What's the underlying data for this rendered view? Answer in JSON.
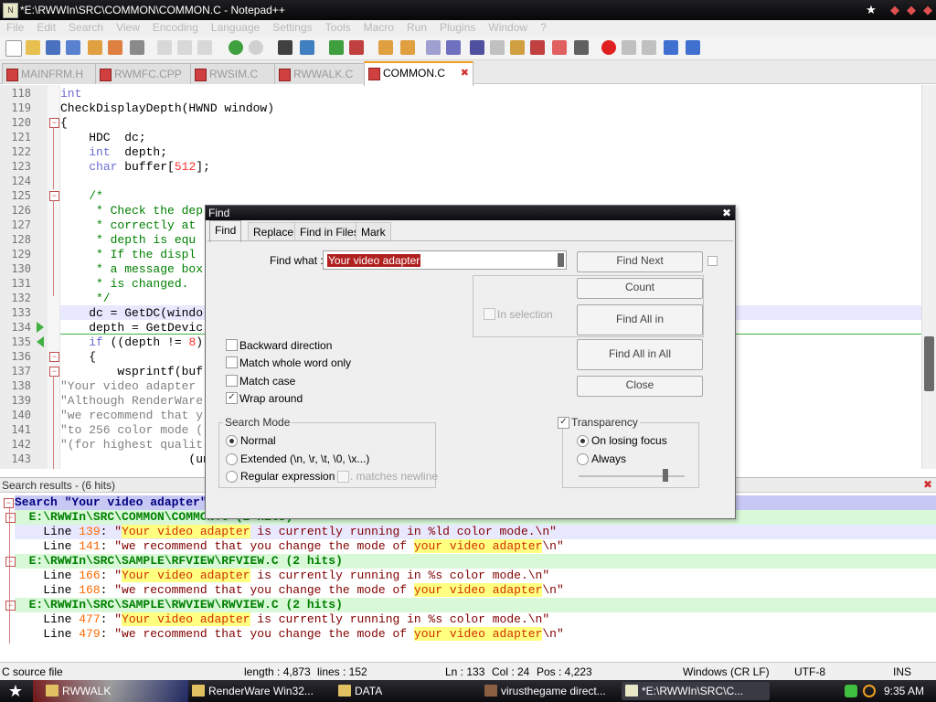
{
  "window": {
    "title": "*E:\\RWWIn\\SRC\\COMMON\\COMMON.C - Notepad++",
    "app_icon": "notepad-plus-icon"
  },
  "menu": [
    "File",
    "Edit",
    "Search",
    "View",
    "Encoding",
    "Language",
    "Settings",
    "Tools",
    "Macro",
    "Run",
    "Plugins",
    "Window",
    "?"
  ],
  "tabs": [
    {
      "label": "MAINFRM.H",
      "active": false
    },
    {
      "label": "RWMFC.CPP",
      "active": false
    },
    {
      "label": "RWSIM.C",
      "active": false
    },
    {
      "label": "RWWALK.C",
      "active": false
    },
    {
      "label": "COMMON.C",
      "active": true
    }
  ],
  "editor": {
    "lines": [
      {
        "n": "118",
        "t": "int"
      },
      {
        "n": "119",
        "t": "CheckDisplayDepth(HWND window)"
      },
      {
        "n": "120",
        "t": "{"
      },
      {
        "n": "121",
        "t": "    HDC  dc;"
      },
      {
        "n": "122",
        "t": "    int  depth;"
      },
      {
        "n": "123",
        "t": "    char buffer[512];"
      },
      {
        "n": "124",
        "t": ""
      },
      {
        "n": "125",
        "t": "    /*"
      },
      {
        "n": "126",
        "t": "     * Check the dep"
      },
      {
        "n": "127",
        "t": "     * correctly at"
      },
      {
        "n": "128",
        "t": "     * depth is equ"
      },
      {
        "n": "129",
        "t": "     * If the displ"
      },
      {
        "n": "130",
        "t": "     * a message box"
      },
      {
        "n": "131",
        "t": "     * is changed."
      },
      {
        "n": "132",
        "t": "     */"
      },
      {
        "n": "133",
        "t": "    dc = GetDC(windo"
      },
      {
        "n": "134",
        "t": "    depth = GetDevic"
      },
      {
        "n": "135",
        "t": "    if ((depth != 8)"
      },
      {
        "n": "136",
        "t": "    {"
      },
      {
        "n": "137",
        "t": "        wsprintf(buf"
      },
      {
        "n": "138",
        "t": "\"Your video adapter"
      },
      {
        "n": "139",
        "t": "\"Although RenderWare"
      },
      {
        "n": "140",
        "t": "\"we recommend that y"
      },
      {
        "n": "141",
        "t": "\"to 256 color mode ("
      },
      {
        "n": "142",
        "t": "\"(for highest qualit"
      },
      {
        "n": "143",
        "t": "                  (un"
      }
    ]
  },
  "search_results": {
    "title": "Search results - (6 hits)",
    "query_line": "Search \"Your video adapter\" (6 hits in 3 files)",
    "files": [
      {
        "path": "E:\\RWWIn\\SRC\\COMMON\\COMMON.C (2 hits)",
        "hits": [
          {
            "prefix": "Line ",
            "num": "139",
            "colon": ": ",
            "pre": "\"",
            "hit": "Your video adapter",
            "post": " is currently running in %ld color mode.\\n\""
          },
          {
            "prefix": "Line ",
            "num": "141",
            "colon": ": ",
            "pre": "\"we recommend that you change the mode of ",
            "hit": "your video adapter",
            "post": "\\n\""
          }
        ]
      },
      {
        "path": "E:\\RWWIn\\SRC\\SAMPLE\\RFVIEW\\RFVIEW.C (2 hits)",
        "hits": [
          {
            "prefix": "Line ",
            "num": "166",
            "colon": ": ",
            "pre": "\"",
            "hit": "Your video adapter",
            "post": " is currently running in %s color mode.\\n\""
          },
          {
            "prefix": "Line ",
            "num": "168",
            "colon": ": ",
            "pre": "\"we recommend that you change the mode of ",
            "hit": "your video adapter",
            "post": "\\n\""
          }
        ]
      },
      {
        "path": "E:\\RWWIn\\SRC\\SAMPLE\\RWVIEW\\RWVIEW.C (2 hits)",
        "hits": [
          {
            "prefix": "Line ",
            "num": "477",
            "colon": ": ",
            "pre": "\"",
            "hit": "Your video adapter",
            "post": " is currently running in %s color mode.\\n\""
          },
          {
            "prefix": "Line ",
            "num": "479",
            "colon": ": ",
            "pre": "\"we recommend that you change the mode of ",
            "hit": "your video adapter",
            "post": "\\n\""
          }
        ]
      }
    ]
  },
  "find_dialog": {
    "title": "Find",
    "tabs": [
      "Find",
      "Replace",
      "Find in Files",
      "Mark"
    ],
    "find_what_label": "Find what :",
    "find_what_value": "Your video adapter",
    "buttons": {
      "find_next": "Find Next",
      "count": "Count",
      "find_all_in": "Find All in",
      "find_all_in_all": "Find All in All",
      "close": "Close"
    },
    "in_selection": "In selection",
    "options": {
      "backward": "Backward direction",
      "whole_word": "Match whole word only",
      "match_case": "Match case",
      "wrap_around": "Wrap around"
    },
    "search_mode": {
      "title": "Search Mode",
      "normal": "Normal",
      "extended": "Extended (\\n, \\r, \\t, \\0, \\x...)",
      "regex": "Regular expression",
      "matches_newline": ". matches newline"
    },
    "transparency": {
      "title": "Transparency",
      "on_losing_focus": "On losing focus",
      "always": "Always",
      "slider_level": 0.82
    }
  },
  "status": {
    "lang": "C source file",
    "length": "length : 4,873",
    "lines": "lines : 152",
    "ln": "Ln : 133",
    "col": "Col : 24",
    "pos": "Pos : 4,223",
    "eol": "Windows (CR LF)",
    "enc": "UTF-8",
    "ins": "INS"
  },
  "taskbar": {
    "items": [
      "RWWALK",
      "RenderWare Win32...",
      "DATA",
      "virusthegame direct...",
      "*E:\\RWWIn\\SRC\\C..."
    ],
    "clock": "9:35 AM"
  }
}
